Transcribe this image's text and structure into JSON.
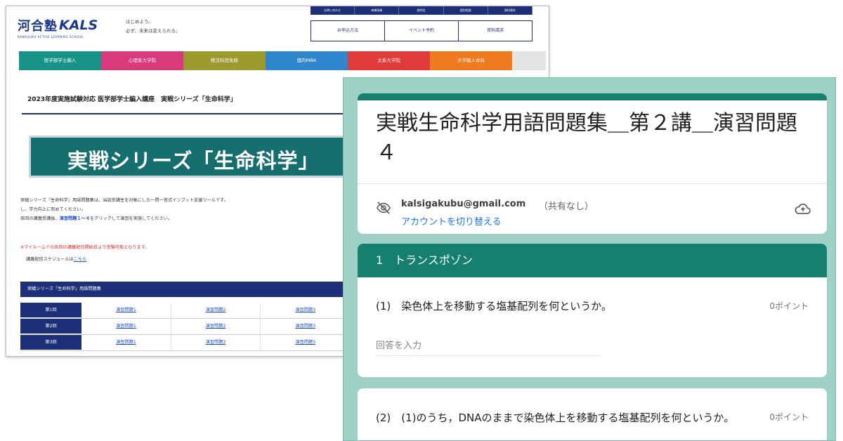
{
  "site": {
    "logo_main": "河合塾",
    "logo_kals": "KALS",
    "logo_sub": "KAWAIJUKU ACTIVE LEARNING SCHOOL",
    "tagline_1": "はじめよう。",
    "tagline_2": "必ず、未来は変えられる。",
    "top_links": [
      "お問い合わせ",
      "体験授業",
      "説明会",
      "個別相談",
      "資料請求"
    ],
    "top_buttons": [
      "お申込方法",
      "イベント予約",
      "資料請求"
    ],
    "nav": [
      {
        "label": "医学部学士編入",
        "color": "#17938a"
      },
      {
        "label": "心理系大学院",
        "color": "#d83a7c"
      },
      {
        "label": "税法科目免除",
        "color": "#9a9a2e"
      },
      {
        "label": "国内MBA",
        "color": "#2f86cc"
      },
      {
        "label": "文系大学院",
        "color": "#e03a3a"
      },
      {
        "label": "大学編入本科",
        "color": "#ef7a20"
      }
    ],
    "headline": "2023年度実施試験対応 医学部学士編入講座　実戦シリーズ「生命科学」",
    "banner": "実戦シリーズ「生命科学」",
    "desc_line1": "実戦シリーズ「生命科学」用語問題集は、当該受講生を対象にした一問一答式インプット支援ツールです。",
    "desc_line2": "し、学力向上に努めてください。",
    "desc_line3_pre": "各回の講義受講後、",
    "desc_line3_link": "演習問題１～４",
    "desc_line3_post": "をクリックして演習を実施してください。",
    "note": "※マイルームでの各回の講義配信開始日より受験可能となります。",
    "sched_pre": "講義配信スケジュールは",
    "sched_link": "こちら",
    "table_title": "実戦シリーズ「生命科学」用語問題集",
    "rows": [
      {
        "label": "第1回",
        "cells": [
          "演習問題1",
          "演習問題2",
          "演習問題3"
        ]
      },
      {
        "label": "第2回",
        "cells": [
          "演習問題1",
          "演習問題2",
          "演習問題3"
        ]
      },
      {
        "label": "第3回",
        "cells": [
          "演習問題1",
          "演習問題2",
          "演習問題3"
        ]
      }
    ]
  },
  "form": {
    "title": "実戦生命科学用語問題集＿第２講＿演習問題４",
    "email": "kalsigakubu@gmail.com",
    "shared": "（共有なし）",
    "switch_account": "アカウントを切り替える",
    "section_title": "1　トランスポゾン",
    "q1_text": "(1)　染色体上を移動する塩基配列を何というか。",
    "q1_points": "0ポイント",
    "answer_placeholder": "回答を入力",
    "q2_text": "(2)　(1)のうち，DNAのままで染色体上を移動する塩基配列を何というか。",
    "q2_points": "0ポイント",
    "accent": "#16806f",
    "background": "#9fd1c7"
  }
}
